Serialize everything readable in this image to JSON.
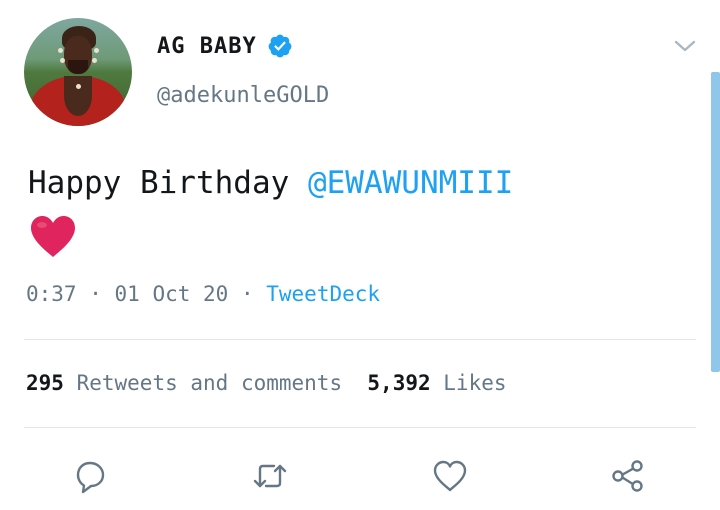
{
  "user": {
    "display_name": "AG BABY",
    "handle": "@adekunleGOLD",
    "verified": true
  },
  "tweet": {
    "text": "Happy Birthday ",
    "mention": "@EWAWUNMIII",
    "emoji": "❤️"
  },
  "meta": {
    "time": "0:37",
    "sep1": " · ",
    "date": "01 Oct 20",
    "sep2": " · ",
    "app": "TweetDeck"
  },
  "stats": {
    "retweets_count": "295",
    "retweets_label": "Retweets and comments",
    "likes_count": "5,392",
    "likes_label": "Likes"
  },
  "icons": {
    "reply": "reply-icon",
    "retweet": "retweet-icon",
    "like": "like-icon",
    "share": "share-icon",
    "menu": "chevron-down-icon"
  },
  "colors": {
    "accent": "#1da1f2",
    "secondary_text": "#657786",
    "primary_text": "#14171a",
    "divider": "#e1e8ed",
    "heart": "#e0245e"
  }
}
